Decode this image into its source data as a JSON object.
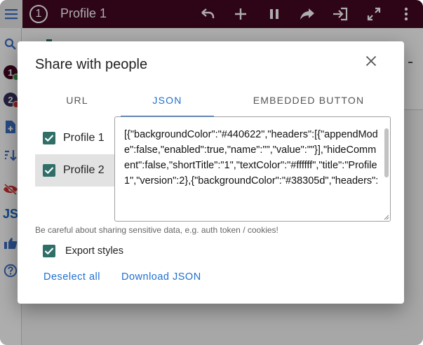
{
  "app": {
    "profile_number": "1",
    "title": "Profile 1",
    "accent": "#440622"
  },
  "toolbar": [
    "undo-icon",
    "add-icon",
    "pause-icon",
    "share-icon",
    "login-icon",
    "fullscreen-icon",
    "more-vert-icon"
  ],
  "sidebar": {
    "badge1": "1",
    "badge2": "2",
    "js_label": "JS"
  },
  "dialog": {
    "title": "Share with people",
    "tabs": [
      {
        "label": "URL",
        "active": false
      },
      {
        "label": "JSON",
        "active": true
      },
      {
        "label": "EMBEDDED BUTTON",
        "active": false
      }
    ],
    "profiles": [
      {
        "label": "Profile 1",
        "checked": true,
        "selected": false
      },
      {
        "label": "Profile 2",
        "checked": true,
        "selected": true
      }
    ],
    "json_text": "[{\"backgroundColor\":\"#440622\",\"headers\":[{\"appendMode\":false,\"enabled\":true,\"name\":\"\",\"value\":\"\"}],\"hideComment\":false,\"shortTitle\":\"1\",\"textColor\":\"#ffffff\",\"title\":\"Profile 1\",\"version\":2},{\"backgroundColor\":\"#38305d\",\"headers\":",
    "warning": "Be careful about sharing sensitive data, e.g. auth token / cookies!",
    "export_styles_label": "Export styles",
    "export_styles_checked": true,
    "deselect_all_label": "Deselect all",
    "download_label": "Download JSON"
  },
  "colors": {
    "checkbox": "#2f6f68",
    "link": "#1e6fd0",
    "badge1": "#440622",
    "badge2": "#38305d"
  }
}
